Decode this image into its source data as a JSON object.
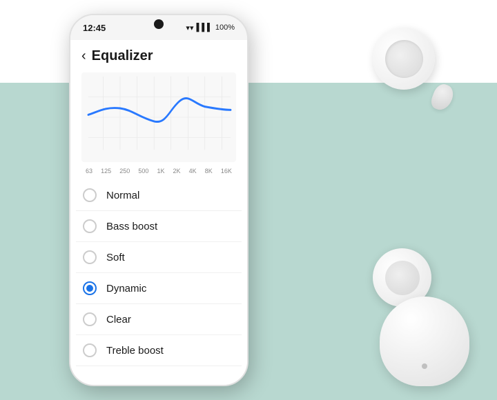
{
  "scene": {
    "background_top_color": "#ffffff",
    "background_bottom_color": "#b8d8d0"
  },
  "phone": {
    "status_bar": {
      "time": "12:45",
      "wifi": "WiFi",
      "signal": "Signal",
      "battery": "100%"
    },
    "header": {
      "back_label": "‹",
      "title": "Equalizer"
    },
    "eq_labels": [
      "63",
      "125",
      "250",
      "500",
      "1K",
      "2K",
      "4K",
      "8K",
      "16K"
    ],
    "options": [
      {
        "id": "normal",
        "label": "Normal",
        "selected": false
      },
      {
        "id": "bass-boost",
        "label": "Bass boost",
        "selected": false
      },
      {
        "id": "soft",
        "label": "Soft",
        "selected": false
      },
      {
        "id": "dynamic",
        "label": "Dynamic",
        "selected": true
      },
      {
        "id": "clear",
        "label": "Clear",
        "selected": false
      },
      {
        "id": "treble-boost",
        "label": "Treble boost",
        "selected": false
      }
    ]
  }
}
